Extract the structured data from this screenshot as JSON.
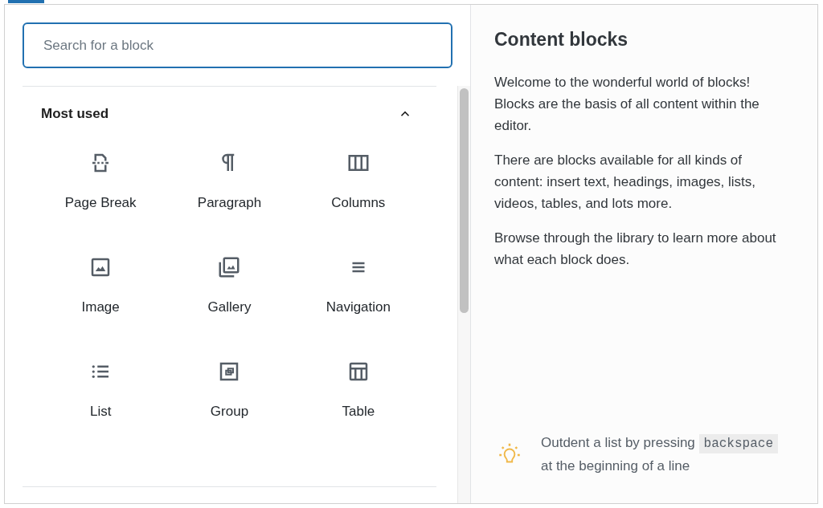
{
  "search": {
    "placeholder": "Search for a block"
  },
  "category": {
    "title": "Most used",
    "expanded": true
  },
  "blocks": [
    {
      "label": "Page Break",
      "kind": "pagebreak"
    },
    {
      "label": "Paragraph",
      "kind": "paragraph"
    },
    {
      "label": "Columns",
      "kind": "columns"
    },
    {
      "label": "Image",
      "kind": "image"
    },
    {
      "label": "Gallery",
      "kind": "gallery"
    },
    {
      "label": "Navigation",
      "kind": "navigation"
    },
    {
      "label": "List",
      "kind": "list"
    },
    {
      "label": "Group",
      "kind": "group"
    },
    {
      "label": "Table",
      "kind": "table"
    }
  ],
  "help": {
    "title": "Content blocks",
    "paragraphs": [
      "Welcome to the wonderful world of blocks! Blocks are the basis of all content within the editor.",
      "There are blocks available for all kinds of content: insert text, headings, images, lists, videos, tables, and lots more.",
      "Browse through the library to learn more about what each block does."
    ]
  },
  "tip": {
    "before": "Outdent a list by pressing",
    "code": "backspace",
    "after": "at the beginning of a line"
  }
}
